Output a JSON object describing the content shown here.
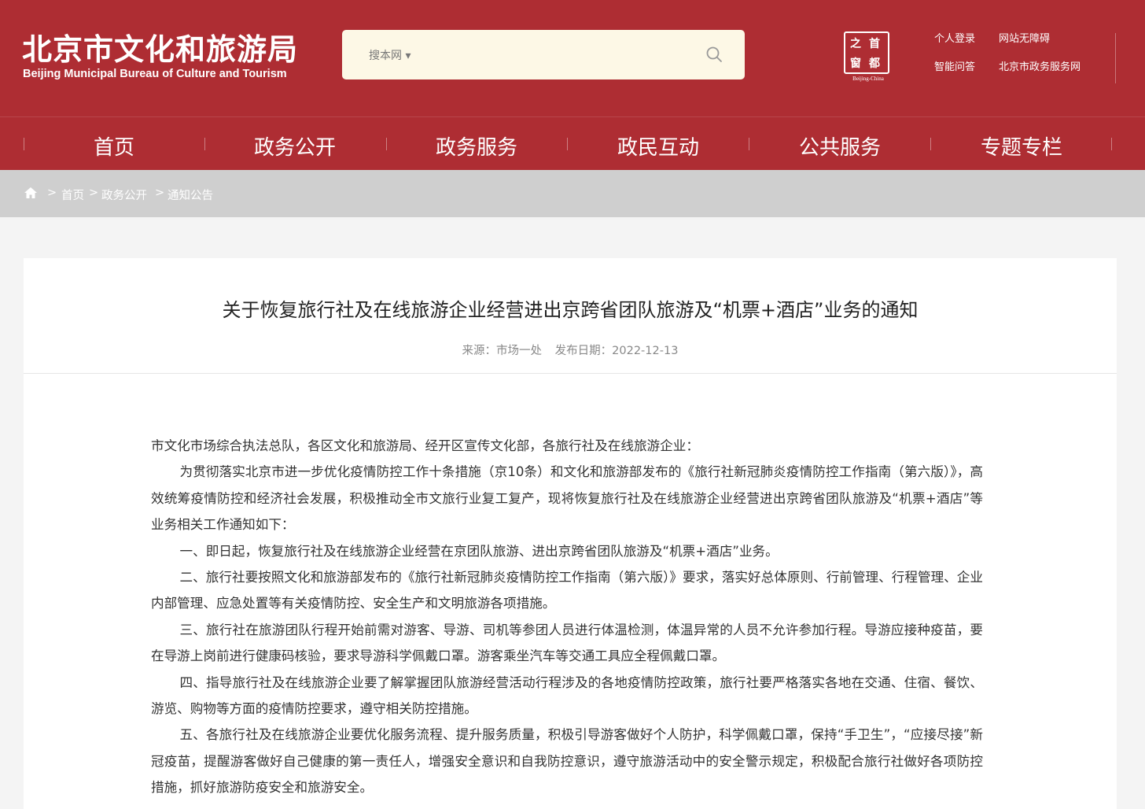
{
  "header": {
    "logo_cn": "北京市文化和旅游局",
    "logo_en": "Beijing Municipal Bureau of Culture and Tourism",
    "search_scope": "搜本网 ▾",
    "search_value": "",
    "seal_chars": [
      "首",
      "都",
      "之",
      "窗"
    ],
    "seal_sub": "Beijing-China",
    "top_links": [
      "个人登录",
      "网站无障碍",
      "智能问答",
      "北京市政务服务网"
    ]
  },
  "nav": {
    "items": [
      "首页",
      "政务公开",
      "政务服务",
      "政民互动",
      "公共服务",
      "专题专栏"
    ]
  },
  "breadcrumb": {
    "sep": ">",
    "items": [
      "首页",
      "政务公开",
      "通知公告"
    ]
  },
  "article": {
    "title": "关于恢复旅行社及在线旅游企业经营进出京跨省团队旅游及“机票+酒店”业务的通知",
    "source": "来源：市场一处",
    "date": "发布日期：2022-12-13",
    "paragraphs": [
      "市文化市场综合执法总队，各区文化和旅游局、经开区宣传文化部，各旅行社及在线旅游企业：",
      "为贯彻落实北京市进一步优化疫情防控工作十条措施（京10条）和文化和旅游部发布的《旅行社新冠肺炎疫情防控工作指南（第六版）》，高效统筹疫情防控和经济社会发展，积极推动全市文旅行业复工复产，现将恢复旅行社及在线旅游企业经营进出京跨省团队旅游及“机票+酒店”等业务相关工作通知如下：",
      "一、即日起，恢复旅行社及在线旅游企业经营在京团队旅游、进出京跨省团队旅游及“机票+酒店”业务。",
      "二、旅行社要按照文化和旅游部发布的《旅行社新冠肺炎疫情防控工作指南（第六版）》要求，落实好总体原则、行前管理、行程管理、企业内部管理、应急处置等有关疫情防控、安全生产和文明旅游各项措施。",
      "三、旅行社在旅游团队行程开始前需对游客、导游、司机等参团人员进行体温检测，体温异常的人员不允许参加行程。导游应接种疫苗，要在导游上岗前进行健康码核验，要求导游科学佩戴口罩。游客乘坐汽车等交通工具应全程佩戴口罩。",
      "四、指导旅行社及在线旅游企业要了解掌握团队旅游经营活动行程涉及的各地疫情防控政策，旅行社要严格落实各地在交通、住宿、餐饮、游览、购物等方面的疫情防控要求，遵守相关防控措施。",
      "五、各旅行社及在线旅游企业要优化服务流程、提升服务质量，积极引导游客做好个人防护，科学佩戴口罩，保持“手卫生”，“应接尽接”新冠疫苗，提醒游客做好自己健康的第一责任人，增强安全意识和自我防控意识，遵守旅游活动中的安全警示规定，积极配合旅行社做好各项防控措施，抓好旅游防疫安全和旅游安全。"
    ]
  }
}
